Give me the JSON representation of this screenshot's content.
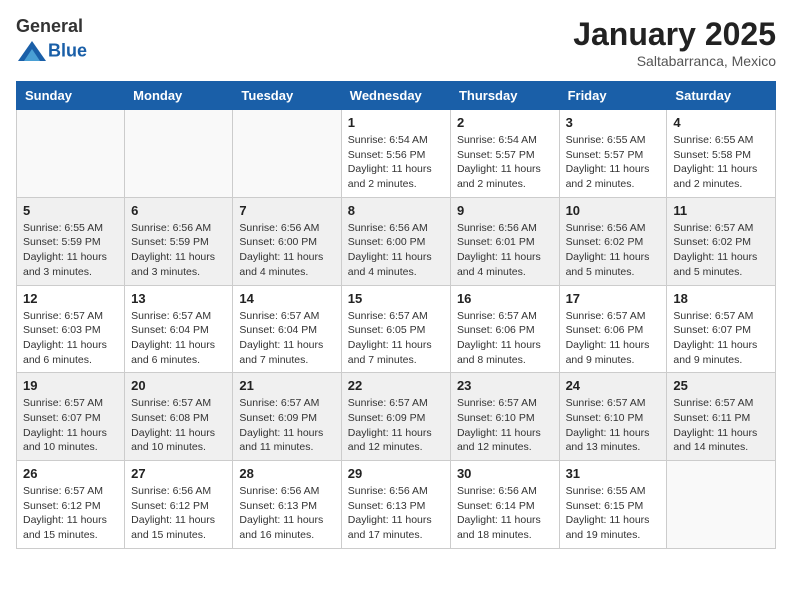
{
  "header": {
    "logo_general": "General",
    "logo_blue": "Blue",
    "month_year": "January 2025",
    "location": "Saltabarranca, Mexico"
  },
  "weekdays": [
    "Sunday",
    "Monday",
    "Tuesday",
    "Wednesday",
    "Thursday",
    "Friday",
    "Saturday"
  ],
  "weeks": [
    [
      {
        "day": "",
        "info": ""
      },
      {
        "day": "",
        "info": ""
      },
      {
        "day": "",
        "info": ""
      },
      {
        "day": "1",
        "info": "Sunrise: 6:54 AM\nSunset: 5:56 PM\nDaylight: 11 hours and 2 minutes."
      },
      {
        "day": "2",
        "info": "Sunrise: 6:54 AM\nSunset: 5:57 PM\nDaylight: 11 hours and 2 minutes."
      },
      {
        "day": "3",
        "info": "Sunrise: 6:55 AM\nSunset: 5:57 PM\nDaylight: 11 hours and 2 minutes."
      },
      {
        "day": "4",
        "info": "Sunrise: 6:55 AM\nSunset: 5:58 PM\nDaylight: 11 hours and 2 minutes."
      }
    ],
    [
      {
        "day": "5",
        "info": "Sunrise: 6:55 AM\nSunset: 5:59 PM\nDaylight: 11 hours and 3 minutes."
      },
      {
        "day": "6",
        "info": "Sunrise: 6:56 AM\nSunset: 5:59 PM\nDaylight: 11 hours and 3 minutes."
      },
      {
        "day": "7",
        "info": "Sunrise: 6:56 AM\nSunset: 6:00 PM\nDaylight: 11 hours and 4 minutes."
      },
      {
        "day": "8",
        "info": "Sunrise: 6:56 AM\nSunset: 6:00 PM\nDaylight: 11 hours and 4 minutes."
      },
      {
        "day": "9",
        "info": "Sunrise: 6:56 AM\nSunset: 6:01 PM\nDaylight: 11 hours and 4 minutes."
      },
      {
        "day": "10",
        "info": "Sunrise: 6:56 AM\nSunset: 6:02 PM\nDaylight: 11 hours and 5 minutes."
      },
      {
        "day": "11",
        "info": "Sunrise: 6:57 AM\nSunset: 6:02 PM\nDaylight: 11 hours and 5 minutes."
      }
    ],
    [
      {
        "day": "12",
        "info": "Sunrise: 6:57 AM\nSunset: 6:03 PM\nDaylight: 11 hours and 6 minutes."
      },
      {
        "day": "13",
        "info": "Sunrise: 6:57 AM\nSunset: 6:04 PM\nDaylight: 11 hours and 6 minutes."
      },
      {
        "day": "14",
        "info": "Sunrise: 6:57 AM\nSunset: 6:04 PM\nDaylight: 11 hours and 7 minutes."
      },
      {
        "day": "15",
        "info": "Sunrise: 6:57 AM\nSunset: 6:05 PM\nDaylight: 11 hours and 7 minutes."
      },
      {
        "day": "16",
        "info": "Sunrise: 6:57 AM\nSunset: 6:06 PM\nDaylight: 11 hours and 8 minutes."
      },
      {
        "day": "17",
        "info": "Sunrise: 6:57 AM\nSunset: 6:06 PM\nDaylight: 11 hours and 9 minutes."
      },
      {
        "day": "18",
        "info": "Sunrise: 6:57 AM\nSunset: 6:07 PM\nDaylight: 11 hours and 9 minutes."
      }
    ],
    [
      {
        "day": "19",
        "info": "Sunrise: 6:57 AM\nSunset: 6:07 PM\nDaylight: 11 hours and 10 minutes."
      },
      {
        "day": "20",
        "info": "Sunrise: 6:57 AM\nSunset: 6:08 PM\nDaylight: 11 hours and 10 minutes."
      },
      {
        "day": "21",
        "info": "Sunrise: 6:57 AM\nSunset: 6:09 PM\nDaylight: 11 hours and 11 minutes."
      },
      {
        "day": "22",
        "info": "Sunrise: 6:57 AM\nSunset: 6:09 PM\nDaylight: 11 hours and 12 minutes."
      },
      {
        "day": "23",
        "info": "Sunrise: 6:57 AM\nSunset: 6:10 PM\nDaylight: 11 hours and 12 minutes."
      },
      {
        "day": "24",
        "info": "Sunrise: 6:57 AM\nSunset: 6:10 PM\nDaylight: 11 hours and 13 minutes."
      },
      {
        "day": "25",
        "info": "Sunrise: 6:57 AM\nSunset: 6:11 PM\nDaylight: 11 hours and 14 minutes."
      }
    ],
    [
      {
        "day": "26",
        "info": "Sunrise: 6:57 AM\nSunset: 6:12 PM\nDaylight: 11 hours and 15 minutes."
      },
      {
        "day": "27",
        "info": "Sunrise: 6:56 AM\nSunset: 6:12 PM\nDaylight: 11 hours and 15 minutes."
      },
      {
        "day": "28",
        "info": "Sunrise: 6:56 AM\nSunset: 6:13 PM\nDaylight: 11 hours and 16 minutes."
      },
      {
        "day": "29",
        "info": "Sunrise: 6:56 AM\nSunset: 6:13 PM\nDaylight: 11 hours and 17 minutes."
      },
      {
        "day": "30",
        "info": "Sunrise: 6:56 AM\nSunset: 6:14 PM\nDaylight: 11 hours and 18 minutes."
      },
      {
        "day": "31",
        "info": "Sunrise: 6:55 AM\nSunset: 6:15 PM\nDaylight: 11 hours and 19 minutes."
      },
      {
        "day": "",
        "info": ""
      }
    ]
  ]
}
